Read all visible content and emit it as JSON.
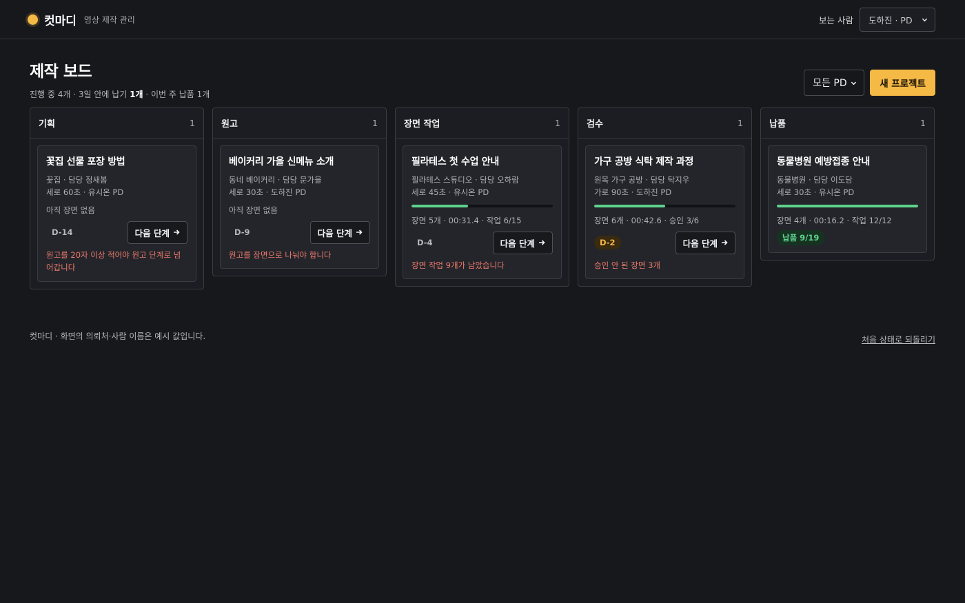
{
  "header": {
    "brand_name": "컷마디",
    "brand_sub": "영상 제작 관리",
    "viewer_label": "보는 사람",
    "viewer_value": "도하진 · PD"
  },
  "page": {
    "title": "제작 보드",
    "summary_prefix": "진행 중 4개 · 3일 안에 납기 ",
    "summary_bold": "1개",
    "summary_suffix": " · 이번 주 납품 1개",
    "pd_filter": "모든 PD",
    "new_project": "새 프로젝트"
  },
  "columns": [
    {
      "title": "기획",
      "count": "1",
      "card": {
        "title": "꽃집 선물 포장 방법",
        "client": "꽃집 · 담당 정새봄",
        "format": "세로 60초 · 유시온 PD",
        "no_scene": "아직 장면 없음",
        "dday": "D-14",
        "next": "다음 단계",
        "warning": "원고를 20자 이상 적어야 원고 단계로 넘어갑니다"
      }
    },
    {
      "title": "원고",
      "count": "1",
      "card": {
        "title": "베이커리 가을 신메뉴 소개",
        "client": "동네 베이커리 · 담당 문가을",
        "format": "세로 30초 · 도하진 PD",
        "no_scene": "아직 장면 없음",
        "dday": "D-9",
        "next": "다음 단계",
        "warning": "원고를 장면으로 나눠야 합니다"
      }
    },
    {
      "title": "장면 작업",
      "count": "1",
      "card": {
        "title": "필라테스 첫 수업 안내",
        "client": "필라테스 스튜디오 · 담당 오하람",
        "format": "세로 45초 · 유시온 PD",
        "progress": 0.4,
        "scene_info": "장면 5개 · 00:31.4 · 작업 6/15",
        "dday": "D-4",
        "next": "다음 단계",
        "warning": "장면 작업 9개가 남았습니다"
      }
    },
    {
      "title": "검수",
      "count": "1",
      "card": {
        "title": "가구 공방 식탁 제작 과정",
        "client": "원목 가구 공방 · 담당 탁지우",
        "format": "가로 90초 · 도하진 PD",
        "progress": 0.5,
        "scene_info": "장면 6개 · 00:42.6 · 승인 3/6",
        "dday": "D-2",
        "next": "다음 단계",
        "warning": "승인 안 된 장면 3개"
      }
    },
    {
      "title": "납품",
      "count": "1",
      "card": {
        "title": "동물병원 예방접종 안내",
        "client": "동물병원 · 담당 이도담",
        "format": "세로 30초 · 유시온 PD",
        "progress": 1.0,
        "scene_info": "장면 4개 · 00:16.2 · 작업 12/12",
        "delivered": "납품 9/19"
      }
    }
  ],
  "footer": {
    "note": "컷마디 · 화면의 의뢰처·사람 이름은 예시 값입니다.",
    "reset": "처음 상태로 되돌리기"
  },
  "colors": {
    "accent": "#f5b945",
    "progress": "#5fd28d",
    "warning": "#f07a6a",
    "background": "#17181c"
  }
}
